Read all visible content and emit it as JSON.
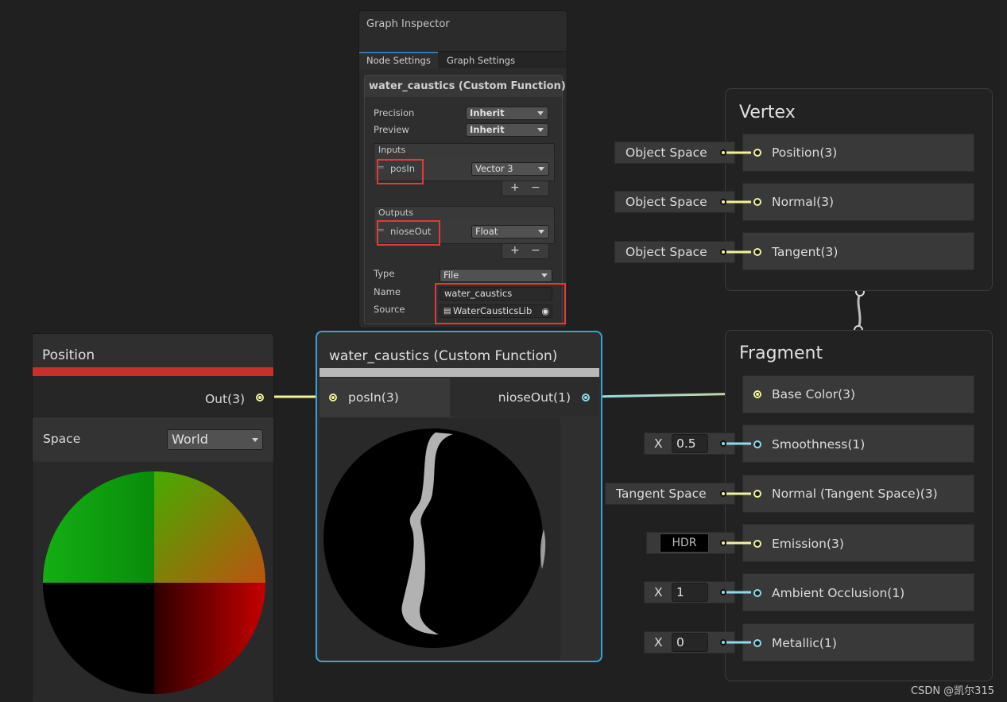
{
  "inspector": {
    "title": "Graph Inspector",
    "tabs": [
      "Node Settings",
      "Graph Settings"
    ],
    "node_title": "water_caustics (Custom Function)",
    "precision_label": "Precision",
    "precision_value": "Inherit",
    "preview_label": "Preview",
    "preview_value": "Inherit",
    "inputs_label": "Inputs",
    "input_name": "posIn",
    "input_type": "Vector 3",
    "outputs_label": "Outputs",
    "output_name": "nioseOut",
    "output_type": "Float",
    "plus": "+",
    "minus": "−",
    "type_label": "Type",
    "type_value": "File",
    "name_label": "Name",
    "name_value": "water_caustics",
    "source_label": "Source",
    "source_value": "WaterCausticsLib"
  },
  "position_node": {
    "title": "Position",
    "out_port": "Out(3)",
    "space_label": "Space",
    "space_value": "World"
  },
  "custom_node": {
    "title": "water_caustics (Custom Function)",
    "in_port": "posIn(3)",
    "out_port": "nioseOut(1)"
  },
  "vertex": {
    "title": "Vertex",
    "blocks": [
      {
        "inline": "Object Space",
        "label": "Position(3)"
      },
      {
        "inline": "Object Space",
        "label": "Normal(3)"
      },
      {
        "inline": "Object Space",
        "label": "Tangent(3)"
      }
    ]
  },
  "fragment": {
    "title": "Fragment",
    "base_color": "Base Color(3)",
    "smoothness_x": "X",
    "smoothness_value": "0.5",
    "smoothness": "Smoothness(1)",
    "normal_inline": "Tangent Space",
    "normal": "Normal (Tangent Space)(3)",
    "emission_inline": "HDR",
    "emission": "Emission(3)",
    "ao_x": "X",
    "ao_value": "1",
    "ao": "Ambient Occlusion(1)",
    "metallic_x": "X",
    "metallic_value": "0",
    "metallic": "Metallic(1)"
  },
  "watermark": "CSDN @凯尔315",
  "colors": {
    "vector3_port": "#f2f29c",
    "float_port": "#8fdbea",
    "selection": "#3aa0d8",
    "highlight_box": "#e03a3a",
    "position_bar": "#c8302a"
  }
}
